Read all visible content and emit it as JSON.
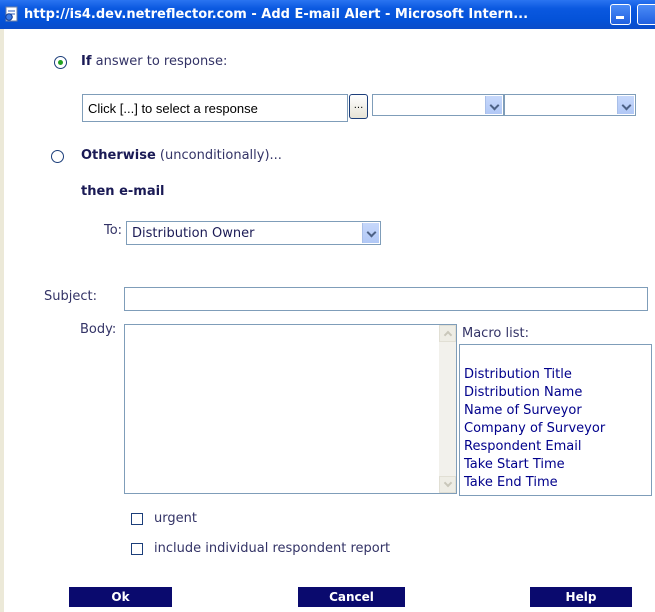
{
  "window": {
    "title": "http://is4.dev.netreflector.com - Add E-mail Alert - Microsoft Intern..."
  },
  "condition": {
    "if_label": "If",
    "if_rest": "answer to response:",
    "response_value": "Click [...] to select a response",
    "browse_label": "...",
    "operator_value": "",
    "answer_value": "",
    "otherwise_label": "Otherwise",
    "otherwise_rest": "(unconditionally)...",
    "then_label": "then e-mail"
  },
  "recipient": {
    "to_label": "To:",
    "to_value": "Distribution Owner"
  },
  "message": {
    "subject_label": "Subject:",
    "subject_value": "",
    "body_label": "Body:",
    "body_value": ""
  },
  "macros": {
    "label": "Macro list:",
    "items": [
      "Distribution Title",
      "Distribution Name",
      "Name of Surveyor",
      "Company of Surveyor",
      "Respondent Email",
      "Take Start Time",
      "Take End Time"
    ]
  },
  "options": {
    "urgent_label": "urgent",
    "report_label": "include individual respondent report"
  },
  "buttons": {
    "ok": "Ok",
    "cancel": "Cancel",
    "help": "Help"
  },
  "colors": {
    "titlebar": "#0a58e0",
    "label_text": "#333366",
    "macro_text": "#00008b",
    "button_bg": "#0a0a6e",
    "radio_selected": "#21a121"
  },
  "icons": {
    "window": "ie-page-icon",
    "minimize": "minimize-icon"
  }
}
